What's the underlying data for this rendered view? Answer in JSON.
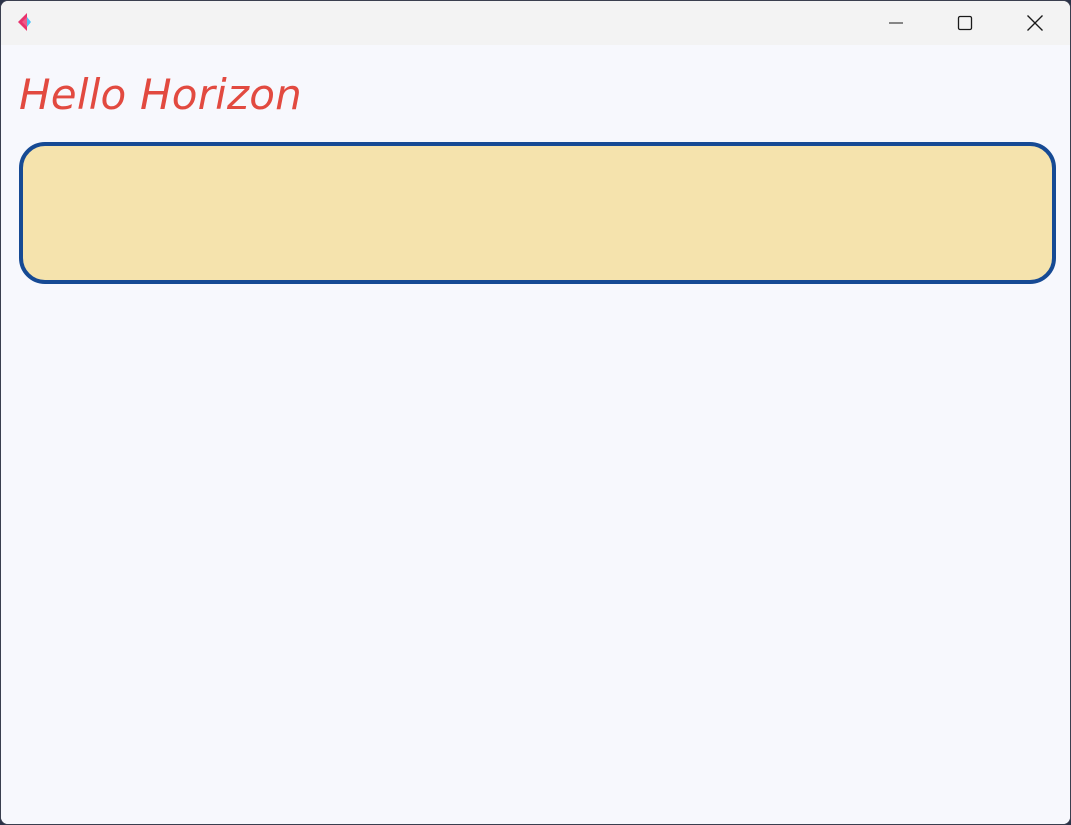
{
  "window": {
    "title": ""
  },
  "titlebar": {
    "app_icon": "flutter-logo-icon",
    "minimize_icon": "minimize-icon",
    "maximize_icon": "maximize-icon",
    "close_icon": "close-icon"
  },
  "main": {
    "heading": "Hello Horizon",
    "text_box": {
      "value": ""
    }
  },
  "colors": {
    "heading": "#e24a40",
    "box_fill": "#f5e3ad",
    "box_border": "#164a94",
    "background": "#f7f8fd",
    "titlebar": "#f3f3f3"
  }
}
